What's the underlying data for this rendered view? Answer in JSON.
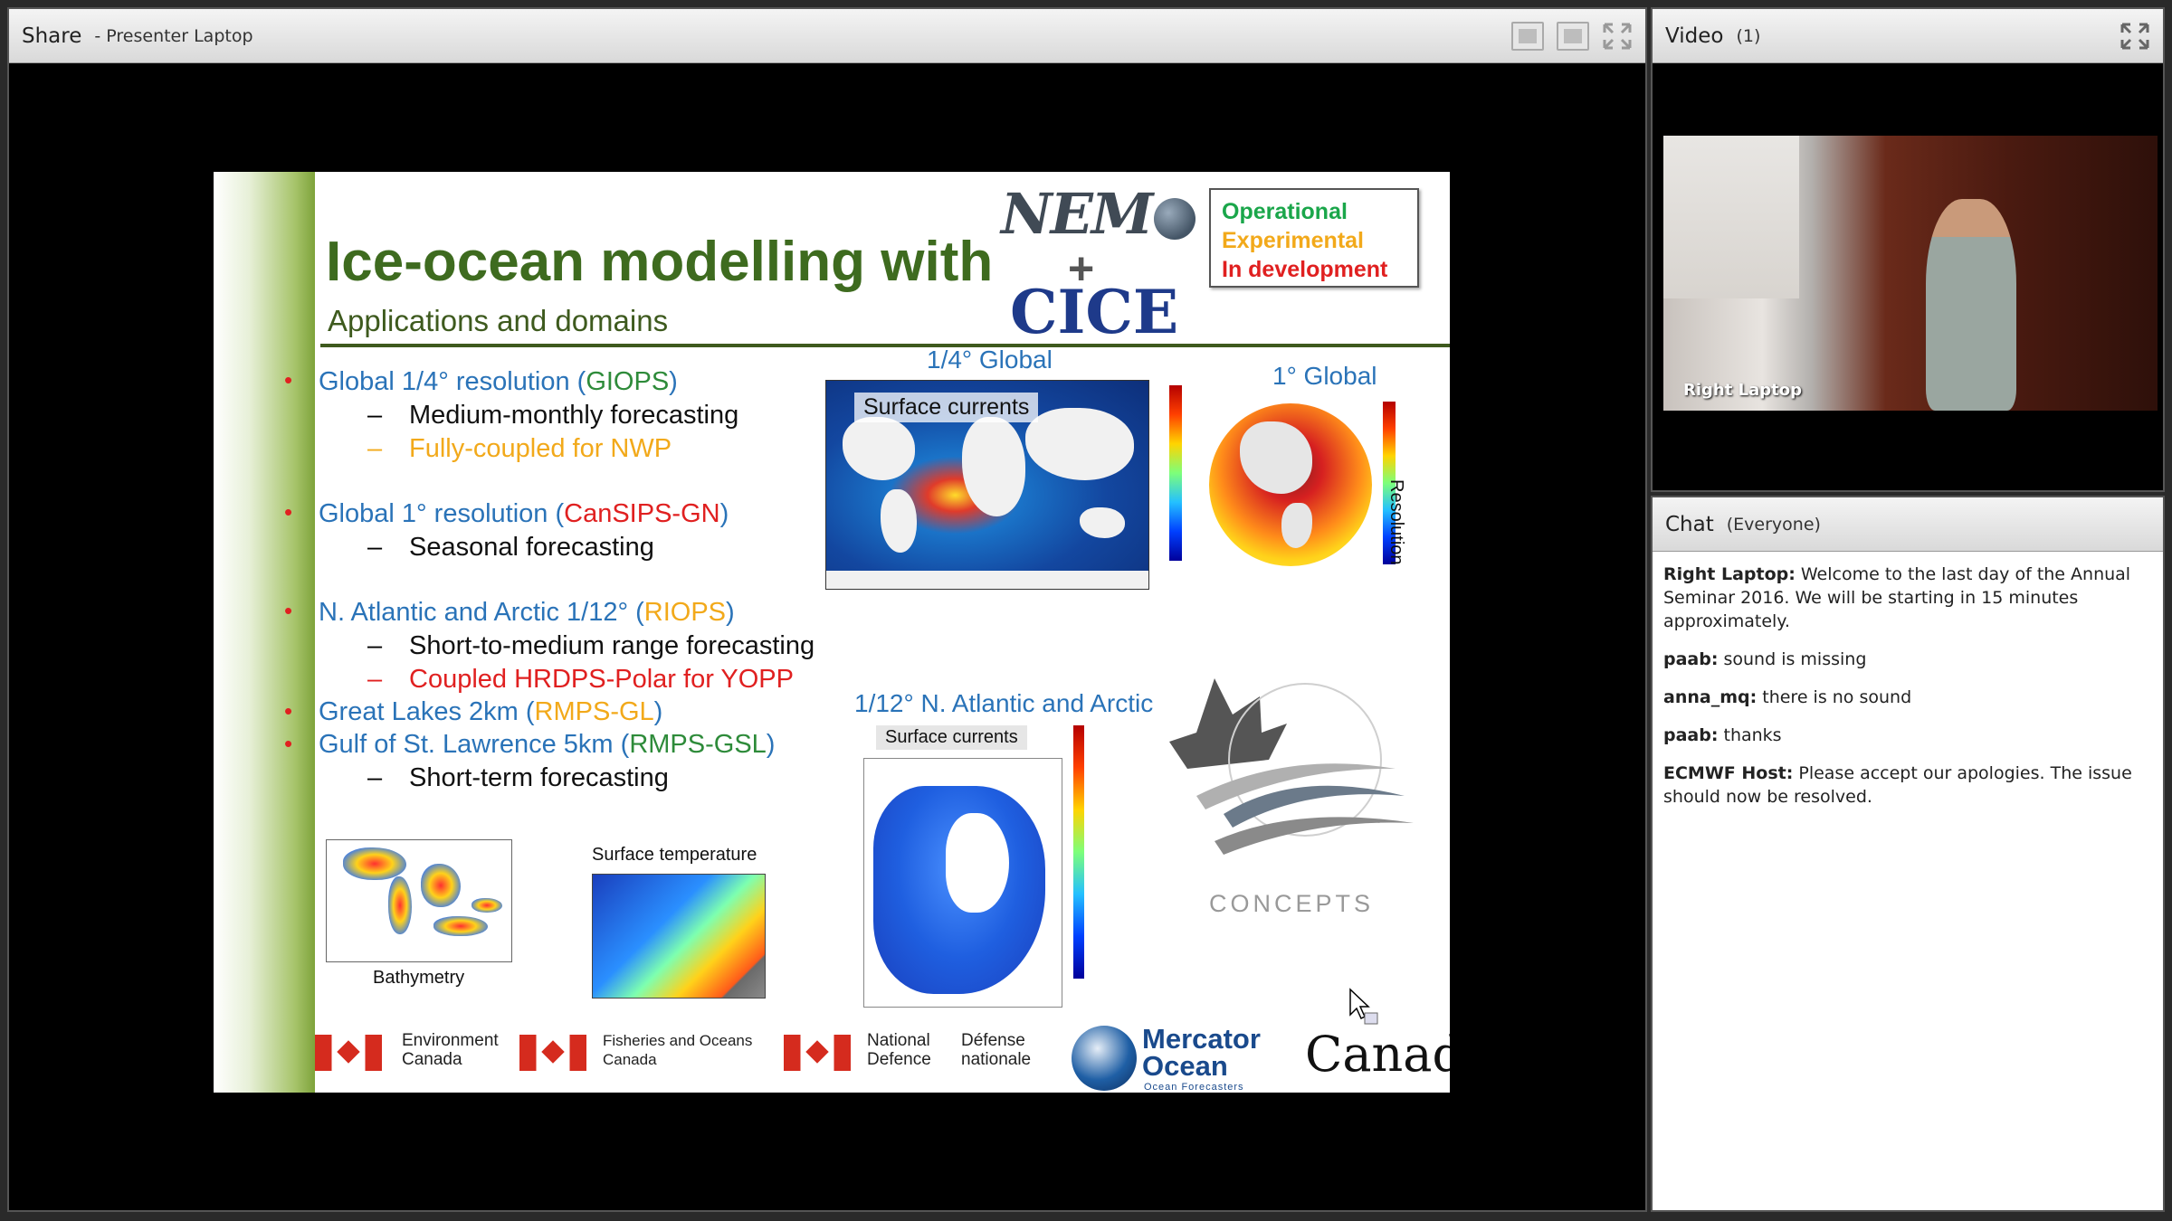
{
  "share": {
    "title": "Share",
    "subtitle": "- Presenter Laptop"
  },
  "video": {
    "title": "Video",
    "count": "(1)",
    "feed_label": "Right Laptop"
  },
  "chat": {
    "title": "Chat",
    "scope": "(Everyone)",
    "messages": [
      {
        "user": "Right Laptop:",
        "text": " Welcome to the last day of the Annual Seminar 2016. We will be starting in 15 minutes approximately."
      },
      {
        "user": "paab:",
        "text": " sound is missing"
      },
      {
        "user": "anna_mq:",
        "text": " there is no sound"
      },
      {
        "user": "paab:",
        "text": " thanks"
      },
      {
        "user": "ECMWF Host:",
        "text": " Please accept our apologies. The issue should now be resolved."
      }
    ]
  },
  "slide": {
    "title": "Ice-ocean modelling with",
    "subtitle": "Applications and domains",
    "logo_nemo": "NEM",
    "logo_plus": "+",
    "logo_cice": "CICE",
    "legend": {
      "operational": "Operational",
      "experimental": "Experimental",
      "in_development": "In development",
      "colors": {
        "operational": "#1aa64a",
        "experimental": "#f2a91a",
        "in_development": "#e02020"
      }
    },
    "bullets": {
      "b1": "Global 1/4° resolution (",
      "b1_code": "GIOPS",
      "b1_end": ")",
      "b1_s1": "Medium-monthly forecasting",
      "b1_s2": "Fully-coupled for NWP",
      "b2": "Global 1° resolution (",
      "b2_code": "CanSIPS-GN",
      "b2_end": ")",
      "b2_s1": "Seasonal forecasting",
      "b3": "N. Atlantic and Arctic 1/12° (",
      "b3_code": "RIOPS",
      "b3_end": ")",
      "b3_s1": "Short-to-medium range forecasting",
      "b3_s2": "Coupled HRDPS-Polar for YOPP",
      "b4": "Great Lakes 2km (",
      "b4_code": "RMPS-GL",
      "b4_end": ")",
      "b5": "Gulf of St. Lawrence 5km (",
      "b5_code": "RMPS-GSL",
      "b5_end": ")",
      "b5_s1": "Short-term forecasting",
      "dash": "–",
      "dot": "•"
    },
    "figures": {
      "global_quarter": "1/4° Global",
      "global_one": "1° Global",
      "surface_currents": "Surface currents",
      "resolution": "Resolution",
      "natl_arctic": "1/12° N. Atlantic and Arctic",
      "surface_currents_2": "Surface currents",
      "surface_temperature": "Surface temperature",
      "bathymetry": "Bathymetry",
      "concepts": "CONCEPTS"
    },
    "footer": {
      "env_canada": "Environment\nCanada",
      "dfo": "Fisheries and Oceans\nCanada",
      "nd": "National\nDefence",
      "dn": "Défense\nnationale",
      "mercator": "Mercator\nOcean",
      "mercator_sub": "Ocean Forecasters",
      "canada": "Canada"
    }
  }
}
